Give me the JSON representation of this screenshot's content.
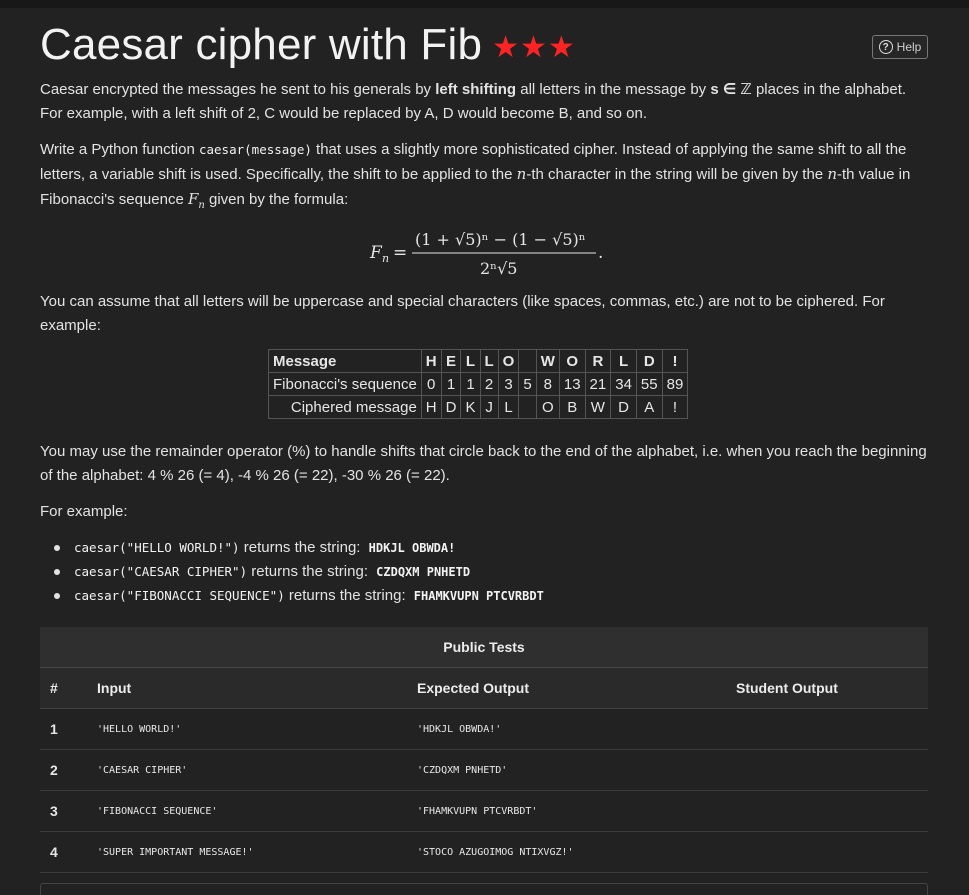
{
  "title": "Caesar cipher with Fib",
  "stars": "★★★",
  "help_label": "Help",
  "para1": {
    "a": "Caesar encrypted the messages he sent to his generals by ",
    "b": "left shifting",
    "c": " all letters in the message by ",
    "d": "s ∈ ℤ",
    "e": " places in the alphabet. For example, with a left shift of 2, C would be replaced by A, D would become B, and so on."
  },
  "para2": {
    "a": "Write a Python function ",
    "code": "caesar(message)",
    "b": " that uses a slightly more sophisticated cipher. Instead of applying the same shift to all the letters, a variable shift is used. Specifically, the shift to be applied to the ",
    "n1": "n",
    "c": "-th character in the string will be given by the ",
    "n2": "n",
    "d": "-th value in Fibonacci's sequence ",
    "fn": "F",
    "fn_sub": "n",
    "e": " given by the formula:"
  },
  "formula": {
    "lhs": "F",
    "lhs_sub": "n",
    "eq": "=",
    "numerator": "(1 + √5)ⁿ − (1 − √5)ⁿ",
    "denominator": "2ⁿ√5",
    "period": "."
  },
  "para3": "You can assume that all letters will be uppercase and special characters (like spaces, commas, etc.) are not to be ciphered. For example:",
  "cipher_table": {
    "labels": [
      "Message",
      "Fibonacci's sequence",
      "Ciphered message"
    ],
    "message": [
      "H",
      "E",
      "L",
      "L",
      "O",
      " ",
      "W",
      "O",
      "R",
      "L",
      "D",
      "!"
    ],
    "fib": [
      "0",
      "1",
      "1",
      "2",
      "3",
      "5",
      "8",
      "13",
      "21",
      "34",
      "55",
      "89"
    ],
    "ciphered": [
      "H",
      "D",
      "K",
      "J",
      "L",
      " ",
      "O",
      "B",
      "W",
      "D",
      "A",
      "!"
    ]
  },
  "para4": "You may use the remainder operator (%) to handle shifts that circle back to the end of the alphabet, i.e. when you reach the beginning of the alphabet: 4 % 26 (= 4), -4 % 26 (= 22), -30 % 26 (= 22).",
  "para5": "For example:",
  "examples": [
    {
      "call": "caesar(\"HELLO WORLD!\")",
      "mid": " returns the string: ",
      "ret": "HDKJL OBWDA!"
    },
    {
      "call": "caesar(\"CAESAR CIPHER\")",
      "mid": " returns the string: ",
      "ret": "CZDQXM PNHETD"
    },
    {
      "call": "caesar(\"FIBONACCI SEQUENCE\")",
      "mid": " returns the string: ",
      "ret": "FHAMKVUPN PTCVRBDT"
    }
  ],
  "tests": {
    "title": "Public Tests",
    "headers": [
      "#",
      "Input",
      "Expected Output",
      "Student Output"
    ],
    "rows": [
      {
        "num": "1",
        "input": "'HELLO WORLD!'",
        "expected": "'HDKJL OBWDA!'",
        "student": ""
      },
      {
        "num": "2",
        "input": "'CAESAR CIPHER'",
        "expected": "'CZDQXM PNHETD'",
        "student": ""
      },
      {
        "num": "3",
        "input": "'FIBONACCI SEQUENCE'",
        "expected": "'FHAMKVUPN PTCVRBDT'",
        "student": ""
      },
      {
        "num": "4",
        "input": "'SUPER IMPORTANT MESSAGE!'",
        "expected": "'STOCO AZUGOIMOG NTIXVGZ!'",
        "student": ""
      }
    ]
  },
  "colors": {
    "background": "#222222",
    "stars": "#ff2222"
  }
}
